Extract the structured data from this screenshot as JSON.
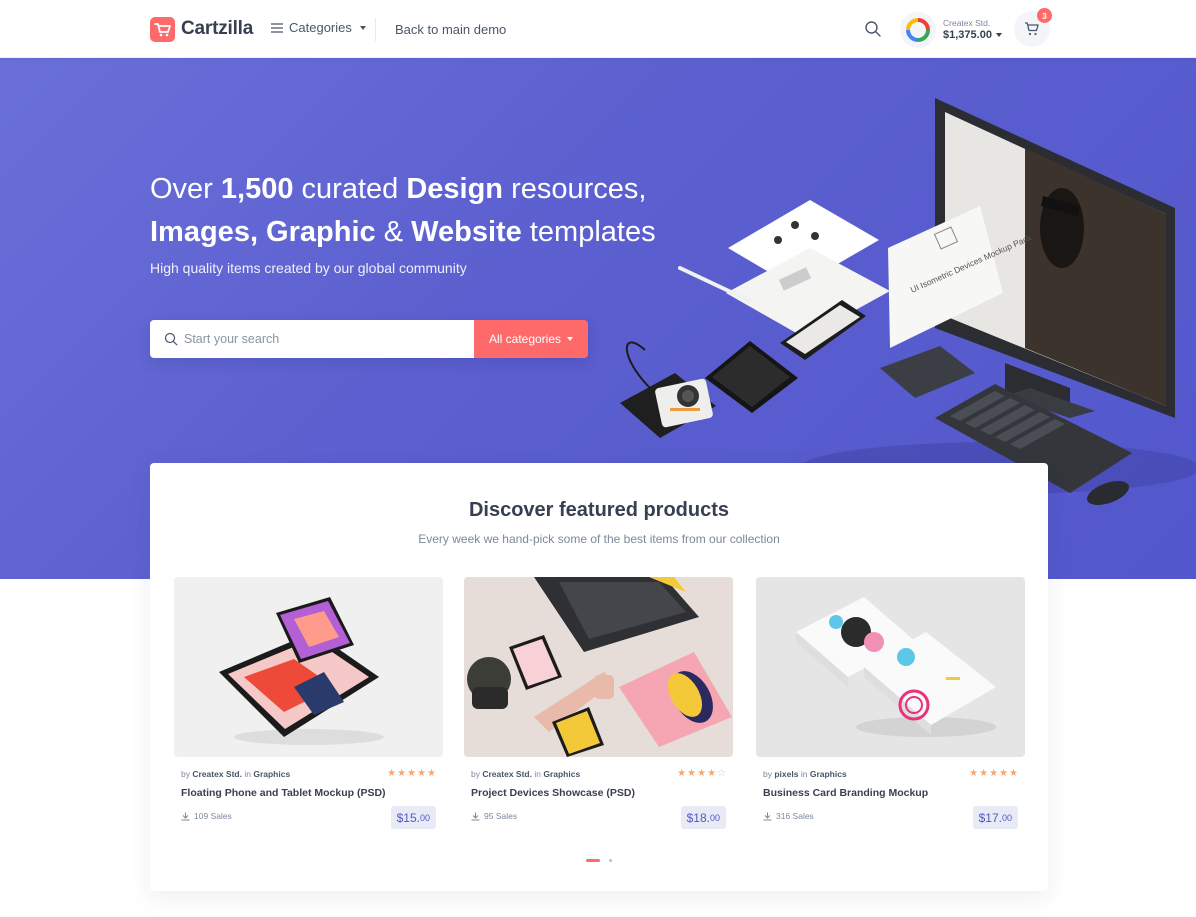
{
  "header": {
    "brand": "Cartzilla",
    "categories_label": "Categories",
    "back_link": "Back to main demo",
    "account_name": "Createx Std.",
    "account_balance": "$1,375.00",
    "cart_count": "3"
  },
  "hero": {
    "title_line1": [
      {
        "t": "Over ",
        "b": false
      },
      {
        "t": "1,500",
        "b": true
      },
      {
        "t": " curated ",
        "b": false
      },
      {
        "t": "Design",
        "b": true
      },
      {
        "t": " resources,",
        "b": false
      }
    ],
    "title_line2": [
      {
        "t": "Images, Graphic",
        "b": true
      },
      {
        "t": " & ",
        "b": false
      },
      {
        "t": "Website",
        "b": true
      },
      {
        "t": " templates",
        "b": false
      }
    ],
    "subtitle": "High quality items created by our global community",
    "search_placeholder": "Start your search",
    "all_categories": "All categories",
    "mockup_label": "UI Isometric Devices Mockup Pack"
  },
  "featured": {
    "title": "Discover featured products",
    "subtitle": "Every week we hand-pick some of the best items from our collection",
    "products": [
      {
        "by": "by",
        "author": "Createx Std.",
        "in": "in",
        "category": "Graphics",
        "rating": 5,
        "title": "Floating Phone and Tablet Mockup (PSD)",
        "sales": "109 Sales",
        "price_main": "$15.",
        "price_cents": "00"
      },
      {
        "by": "by",
        "author": "Createx Std.",
        "in": "in",
        "category": "Graphics",
        "rating": 4,
        "title": "Project Devices Showcase (PSD)",
        "sales": "95 Sales",
        "price_main": "$18.",
        "price_cents": "00"
      },
      {
        "by": "by",
        "author": "pixels",
        "in": "in",
        "category": "Graphics",
        "rating": 5,
        "title": "Business Card Branding Mockup",
        "sales": "316 Sales",
        "price_main": "$17.",
        "price_cents": "00"
      }
    ],
    "carousel_pages": 2,
    "carousel_active": 0
  },
  "colors": {
    "accent": "#fe696a",
    "hero": "#5b5fcf",
    "price_text": "#5257cc",
    "star": "#fea569"
  },
  "icons": [
    "brand-cart-icon",
    "menu-icon",
    "search-icon",
    "cart-icon",
    "download-icon",
    "star-icon"
  ]
}
